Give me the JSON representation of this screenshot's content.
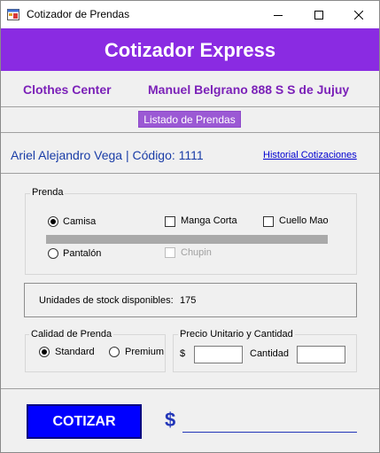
{
  "window": {
    "title": "Cotizador de Prendas",
    "minimize_glyph": "—",
    "maximize_glyph": "☐",
    "close_glyph": "✕"
  },
  "banner": {
    "title": "Cotizador Express"
  },
  "store": {
    "name": "Clothes Center",
    "address": "Manuel Belgrano 888 S S de Jujuy"
  },
  "list_button": {
    "label": "Listado de Prendas"
  },
  "user": {
    "info": "Ariel Alejandro Vega | Código: 1111",
    "history_link": "Historial  Cotizaciones"
  },
  "prenda": {
    "legend": "Prenda",
    "camisa": {
      "label": "Camisa",
      "checked": true
    },
    "manga_corta": {
      "label": "Manga Corta",
      "checked": false
    },
    "cuello_mao": {
      "label": "Cuello Mao",
      "checked": false
    },
    "pantalon": {
      "label": "Pantalón",
      "checked": false
    },
    "chupin": {
      "label": "Chupin",
      "checked": false,
      "enabled": false
    }
  },
  "stock": {
    "label": "Unidades de stock disponibles:",
    "value": "175"
  },
  "calidad": {
    "legend": "Calidad de Prenda",
    "standard": {
      "label": "Standard",
      "checked": true
    },
    "premium": {
      "label": "Premium",
      "checked": false
    }
  },
  "precio": {
    "legend": "Precio Unitario y Cantidad",
    "currency_label": "$",
    "price_value": "",
    "quantity_label": "Cantidad",
    "quantity_value": ""
  },
  "quote": {
    "button_label": "COTIZAR",
    "currency": "$",
    "total": ""
  },
  "colors": {
    "banner": "#8a2be2",
    "store_text": "#7b21b8",
    "user_text": "#1a3da7",
    "link": "#0000d0",
    "cotizar_button": "#0000ff"
  }
}
